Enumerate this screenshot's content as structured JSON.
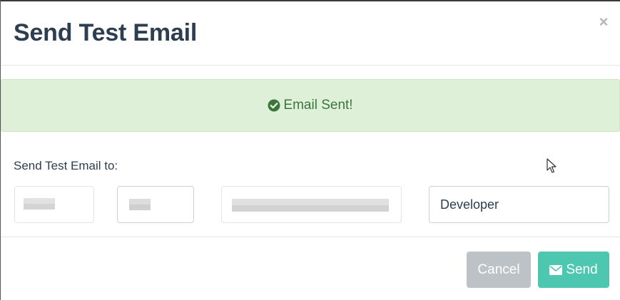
{
  "dialog": {
    "title": "Send Test Email",
    "close_glyph": "×"
  },
  "alert": {
    "icon": "check-circle-icon",
    "message": "Email Sent!",
    "color": "#3c763d",
    "background": "#dff0d8"
  },
  "form": {
    "label": "Send Test Email to:",
    "fields": [
      {
        "value": "",
        "redacted": true
      },
      {
        "value": "",
        "redacted": true
      },
      {
        "value": "",
        "redacted": true
      },
      {
        "value": "Developer",
        "redacted": false
      }
    ]
  },
  "footer": {
    "cancel_label": "Cancel",
    "send_label": "Send",
    "send_icon": "envelope-icon",
    "cancel_color": "#bcc2c6",
    "send_color": "#4ec7b0"
  }
}
